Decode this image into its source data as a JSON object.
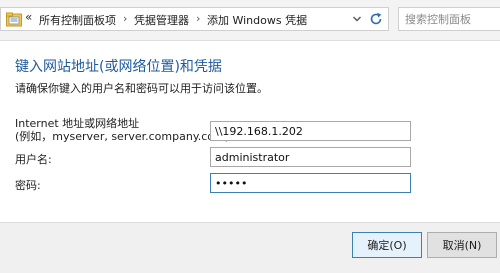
{
  "address_bar": {
    "breadcrumbs": [
      "所有控制面板项",
      "凭据管理器",
      "添加 Windows 凭据"
    ],
    "separator": "›",
    "overflow": "«",
    "icons": [
      "folder-icon",
      "chevron-down-icon",
      "refresh-icon"
    ]
  },
  "search": {
    "placeholder": "搜索控制面板"
  },
  "page": {
    "title": "键入网站地址(或网络位置)和凭据",
    "description": "请确保你键入的用户名和密码可以用于访问该位置。"
  },
  "form": {
    "address_label_line1": "Internet 地址或网络地址",
    "address_label_line2": "(例如，myserver, server.company.com):",
    "address_value": "\\\\192.168.1.202",
    "username_label": "用户名:",
    "username_value": "administrator",
    "password_label": "密码:",
    "password_value": "12345"
  },
  "footer": {
    "ok_label": "确定(O)",
    "cancel_label": "取消(N)"
  },
  "colors": {
    "title": "#1e5a9e",
    "focus_border": "#3c7fb1"
  }
}
